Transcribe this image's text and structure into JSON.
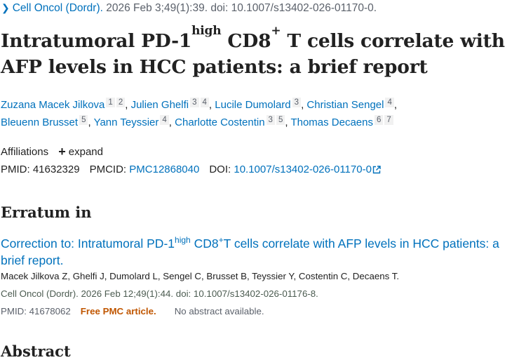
{
  "journal_citation": {
    "journal": "Cell Oncol (Dordr).",
    "details": " 2026 Feb 3;49(1):39. doi: 10.1007/s13402-026-01170-0."
  },
  "article": {
    "title_part1": "Intratumoral PD-1",
    "title_sup1": "high",
    "title_part2": " CD8",
    "title_sup2": "+",
    "title_part3": " T cells correlate with AFP levels in HCC patients: a brief report"
  },
  "authors": [
    {
      "name": "Zuzana Macek Jilkova",
      "affs": [
        "1",
        "2"
      ]
    },
    {
      "name": "Julien Ghelfi",
      "affs": [
        "3",
        "4"
      ]
    },
    {
      "name": "Lucile Dumolard",
      "affs": [
        "3"
      ]
    },
    {
      "name": "Christian Sengel",
      "affs": [
        "4"
      ]
    },
    {
      "name": "Bleuenn Brusset",
      "affs": [
        "5"
      ]
    },
    {
      "name": "Yann Teyssier",
      "affs": [
        "4"
      ]
    },
    {
      "name": "Charlotte Costentin",
      "affs": [
        "3",
        "5"
      ]
    },
    {
      "name": "Thomas Decaens",
      "affs": [
        "6",
        "7"
      ]
    }
  ],
  "affiliations": {
    "label": "Affiliations",
    "expand_label": "expand"
  },
  "identifiers": {
    "pmid_label": "PMID:",
    "pmid": "41632329",
    "pmcid_label": "PMCID:",
    "pmcid": "PMC12868040",
    "doi_label": "DOI:",
    "doi": "10.1007/s13402-026-01170-0"
  },
  "erratum": {
    "heading": "Erratum in",
    "title_part1": "Correction to: Intratumoral PD-1",
    "title_sup1": "high",
    "title_part2": " CD8",
    "title_sup2": "+",
    "title_part3": "T cells correlate with AFP levels in HCC patients: a brief report.",
    "authors": "Macek Jilkova Z, Ghelfi J, Dumolard L, Sengel C, Brusset B, Teyssier Y, Costentin C, Decaens T.",
    "citation": "Cell Oncol (Dordr). 2026 Feb 12;49(1):44. doi: 10.1007/s13402-026-01176-8.",
    "pmid": "PMID: 41678062",
    "free_label": "Free PMC article.",
    "no_abstract": "No abstract available."
  },
  "abstract_heading": "Abstract"
}
